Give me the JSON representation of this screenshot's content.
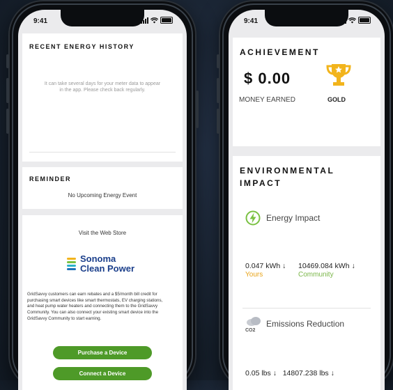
{
  "left_phone": {
    "status_time": "9:41",
    "history": {
      "title": "RECENT ENERGY HISTORY",
      "message": "It can take several days for your meter data to appear in the app. Please check back regularly."
    },
    "reminder": {
      "title": "REMINDER",
      "text": "No Upcoming Energy Event"
    },
    "store": {
      "heading": "Visit the Web Store",
      "logo_line1": "Sonoma",
      "logo_line2": "Clean Power",
      "description": "GridSavvy customers can earn rebates and a $5/month bill credit for purchasing smart devices like smart thermostats, EV charging stations, and heat pump water heaters and connecting them to the GridSavvy Community. You can also connect your existing smart device into the GridSavvy Community to start earning.",
      "purchase_label": "Purchase a Device",
      "connect_label": "Connect a Device"
    }
  },
  "right_phone": {
    "status_time": "9:41",
    "achievement": {
      "title": "ACHIEVEMENT",
      "money_value": "$ 0.00",
      "money_label": "MONEY EARNED",
      "tier_label": "GOLD"
    },
    "environment": {
      "title_line1": "ENVIRONMENTAL",
      "title_line2": "IMPACT",
      "energy_label": "Energy Impact",
      "yours_value": "0.047 kWh ↓",
      "yours_label": "Yours",
      "community_value": "10469.084 kWh ↓",
      "community_label": "Community",
      "emissions_label": "Emissions Reduction",
      "co2_text": "CO2",
      "bottom_partial": "0.05 lbs ↓   14807.238 lbs ↓"
    }
  },
  "colors": {
    "green_button": "#4e9a28",
    "yours_color": "#e8a317",
    "community_color": "#7ab648",
    "gold": "#f2b41c",
    "bolt_green": "#7ac143"
  }
}
